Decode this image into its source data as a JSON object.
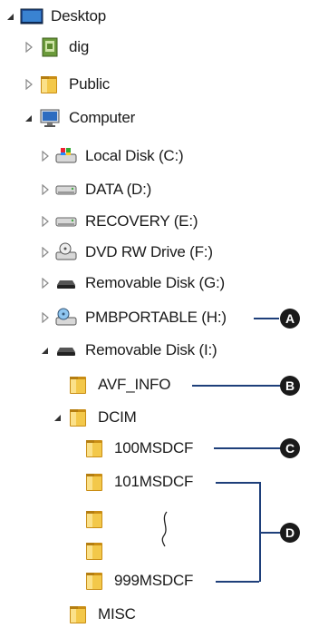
{
  "tree": {
    "desktop": "Desktop",
    "dig": "dig",
    "public": "Public",
    "computer": "Computer",
    "local_disk_c": "Local Disk (C:)",
    "data_d": "DATA (D:)",
    "recovery_e": "RECOVERY (E:)",
    "dvd_f": "DVD RW Drive (F:)",
    "removable_g": "Removable Disk (G:)",
    "pmbportable_h": "PMBPORTABLE (H:)",
    "removable_i": "Removable Disk (I:)",
    "avf_info": "AVF_INFO",
    "dcim": "DCIM",
    "f100": "100MSDCF",
    "f101": "101MSDCF",
    "f999": "999MSDCF",
    "misc": "MISC"
  },
  "callouts": {
    "a": "A",
    "b": "B",
    "c": "C",
    "d": "D"
  },
  "colors": {
    "leader": "#1e3f7a",
    "folder": "#e8b531",
    "callout_bg": "#1a1a1a"
  }
}
